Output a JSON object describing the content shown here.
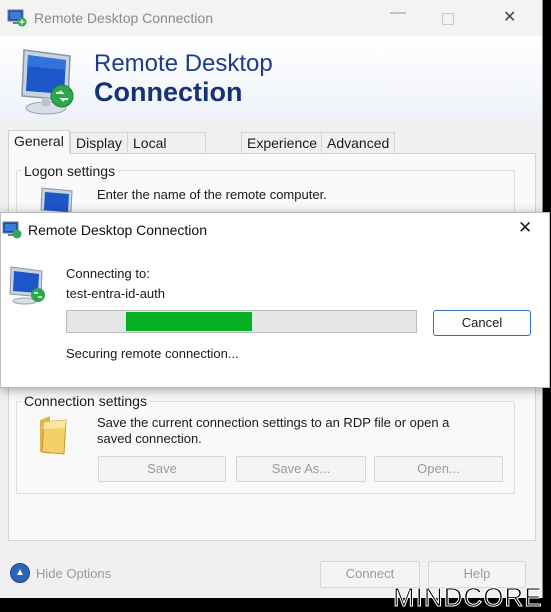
{
  "window": {
    "title": "Remote Desktop Connection"
  },
  "banner": {
    "line1": "Remote Desktop",
    "line2": "Connection"
  },
  "tabs": [
    "General",
    "Display",
    "Local Resources",
    "Experience",
    "Advanced"
  ],
  "logon": {
    "group_label": "Logon settings",
    "prompt": "Enter the name of the remote computer."
  },
  "connection_settings": {
    "group_label": "Connection settings",
    "description": "Save the current connection settings to an RDP file or open a saved connection.",
    "save_label": "Save",
    "save_as_label": "Save As...",
    "open_label": "Open..."
  },
  "footer": {
    "hide_options_label": "Hide Options",
    "connect_label": "Connect",
    "help_label": "Help"
  },
  "dialog": {
    "title": "Remote Desktop Connection",
    "connecting_label": "Connecting to:",
    "host": "test-entra-id-auth",
    "cancel_label": "Cancel",
    "status": "Securing remote connection...",
    "progress_start": 0.17,
    "progress_end": 0.53,
    "progress_color": "#06b025"
  },
  "watermark": "MINDCORE",
  "icons": {
    "app": "remote-desktop-monitor-icon",
    "folder": "folder-icon",
    "hide_options": "chevron-up-icon",
    "close": "close-icon"
  }
}
